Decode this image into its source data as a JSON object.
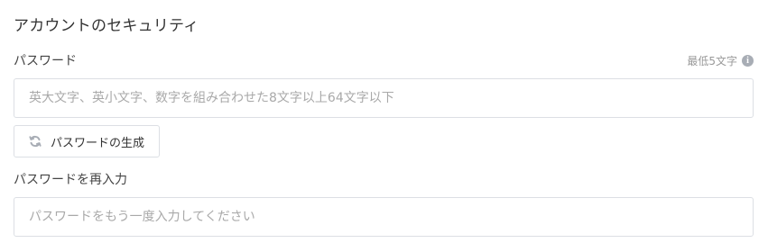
{
  "section": {
    "title": "アカウントのセキュリティ"
  },
  "password": {
    "label": "パスワード",
    "hint": "最低5文字",
    "hint_icon": "info-icon",
    "placeholder": "英大文字、英小文字、数字を組み合わせた8文字以上64文字以下",
    "value": ""
  },
  "generate": {
    "label": "パスワードの生成",
    "icon": "refresh-icon"
  },
  "confirm": {
    "label": "パスワードを再入力",
    "placeholder": "パスワードをもう一度入力してください",
    "value": ""
  },
  "colors": {
    "border": "#dcdfe4",
    "placeholder": "#a9a9a9",
    "hint": "#999999",
    "icon": "#a8adb5"
  }
}
